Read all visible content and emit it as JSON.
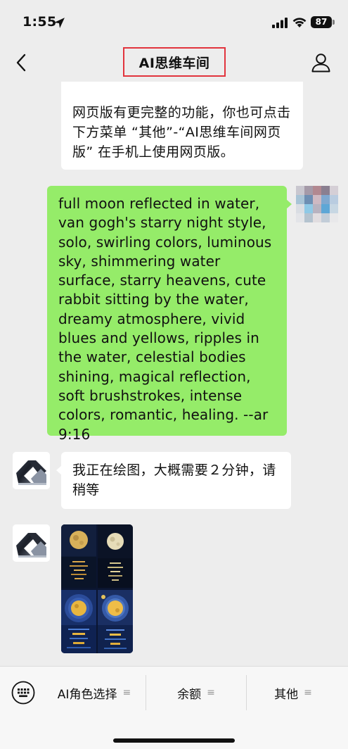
{
  "status_bar": {
    "time": "1:55",
    "battery": "87"
  },
  "nav": {
    "title": "AI思维车间",
    "back_icon": "chevron-left-icon",
    "profile_icon": "person-icon"
  },
  "messages": {
    "top_notice": "网页版有更完整的功能，你也可点击下方菜单 “其他”-“AI思维车间网页版” 在手机上使用网页版。",
    "prompt": "full moon reflected in water, van gogh's starry night style, solo, swirling colors, luminous sky, shimmering water surface, starry heavens, cute rabbit sitting by the water, dreamy atmosphere, vivid blues and yellows, ripples in the water, celestial bodies shining, magical reflection, soft brushstrokes, intense colors, romantic, healing. --ar 9:16",
    "bot_status": "我正在绘图，大概需要２分钟，请稍等"
  },
  "bottom_menu": {
    "keyboard_icon": "keyboard-icon",
    "items": [
      {
        "label": "AI角色选择"
      },
      {
        "label": "余额"
      },
      {
        "label": "其他"
      }
    ],
    "lines_glyph": "≡"
  },
  "colors": {
    "green_bubble": "#95ec69",
    "background": "#ededed",
    "highlight_box": "#e2343d"
  }
}
